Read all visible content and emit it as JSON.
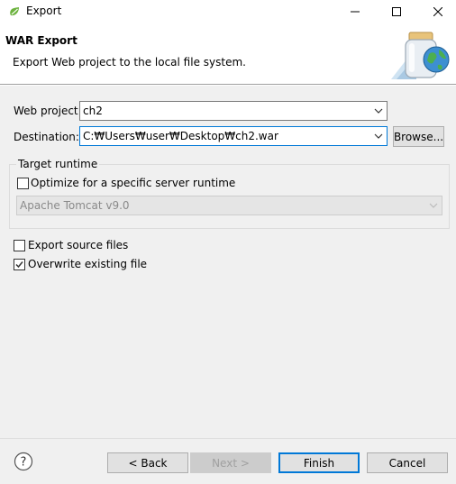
{
  "window": {
    "title": "Export",
    "app_icon": "eclipse-spring-icon",
    "minimize_icon": "minimize-icon",
    "maximize_icon": "maximize-icon",
    "close_icon": "close-icon"
  },
  "banner": {
    "title": "WAR Export",
    "description": "Export Web project to the local file system.",
    "graphic_icon": "jar-globe-icon"
  },
  "form": {
    "web_project_label": "Web project:",
    "web_project_value": "ch2",
    "destination_label": "Destination:",
    "destination_value": "C:₩Users₩user₩Desktop₩ch2.war",
    "browse_label": "Browse...",
    "target_runtime_group": "Target runtime",
    "optimize_label": "Optimize for a specific server runtime",
    "optimize_checked": false,
    "runtime_value": "Apache Tomcat v9.0",
    "export_source_label": "Export source files",
    "export_source_checked": false,
    "overwrite_label": "Overwrite existing file",
    "overwrite_checked": true
  },
  "footer": {
    "help_icon": "help-icon",
    "back_label": "< Back",
    "next_label": "Next >",
    "finish_label": "Finish",
    "cancel_label": "Cancel"
  },
  "colors": {
    "accent": "#0078d7",
    "dialog_bg": "#f0f0f0",
    "disabled_text": "#8a8a8a"
  }
}
